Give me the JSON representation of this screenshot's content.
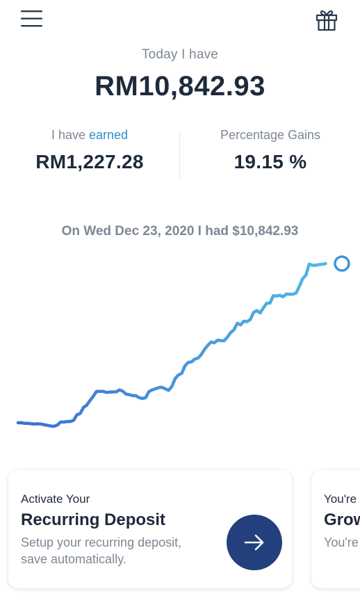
{
  "header": {
    "menu_icon": "hamburger-menu-icon",
    "gift_icon": "gift-icon"
  },
  "summary": {
    "today_label": "Today I have",
    "balance": "RM10,842.93"
  },
  "stats": {
    "earned_prefix": "I have ",
    "earned_accent": "earned",
    "earned_value": "RM1,227.28",
    "gains_label": "Percentage Gains",
    "gains_value": "19.15 %"
  },
  "chart": {
    "caption": "On Wed Dec 23, 2020 I had $10,842.93",
    "line_color_start": "#3d6fcf",
    "line_color_end": "#52b8e6",
    "marker_color": "#3f93d8"
  },
  "chart_data": {
    "type": "line",
    "x": [
      0,
      1,
      2,
      3,
      4,
      5,
      6,
      7,
      8,
      9,
      10,
      11,
      12,
      13,
      14,
      15,
      16,
      17,
      18,
      19,
      20,
      21,
      22,
      23,
      24,
      25,
      26,
      27,
      28,
      29,
      30,
      31,
      32,
      33,
      34,
      35,
      36,
      37,
      38,
      39,
      40,
      41,
      42,
      43,
      44,
      45,
      46,
      47,
      48,
      49,
      50,
      51,
      52,
      53,
      54,
      55,
      56,
      57,
      58,
      59,
      60,
      61,
      62,
      63,
      64,
      65,
      66,
      67,
      68,
      69,
      70,
      71,
      72,
      73,
      74,
      75,
      76,
      77,
      78,
      79,
      80,
      81,
      82,
      83,
      84,
      85,
      86,
      87,
      88,
      89,
      90,
      91,
      92,
      93,
      94,
      95,
      96,
      97,
      98,
      99
    ],
    "values": [
      9614,
      9614,
      9612,
      9612,
      9610,
      9609,
      9610,
      9609,
      9606,
      9604,
      9601,
      9600,
      9605,
      9617,
      9617,
      9619,
      9619,
      9624,
      9646,
      9651,
      9675,
      9684,
      9703,
      9720,
      9739,
      9739,
      9739,
      9735,
      9736,
      9737,
      9737,
      9745,
      9740,
      9728,
      9726,
      9722,
      9722,
      9714,
      9711,
      9714,
      9738,
      9745,
      9749,
      9754,
      9755,
      9749,
      9743,
      9758,
      9789,
      9804,
      9810,
      9840,
      9854,
      9856,
      9867,
      9871,
      9885,
      9906,
      9922,
      9935,
      9932,
      9942,
      9941,
      9940,
      9955,
      9973,
      9984,
      10010,
      10003,
      10018,
      10016,
      10025,
      10053,
      10060,
      10051,
      10071,
      10089,
      10090,
      10119,
      10118,
      10121,
      10115,
      10126,
      10125,
      10125,
      10130,
      10157,
      10187,
      10201,
      10245,
      10240,
      10240,
      10243,
      10244,
      10247
    ],
    "title": "On Wed Dec 23, 2020 I had $10,842.93",
    "grid": false,
    "legend": "none"
  },
  "cards": [
    {
      "kicker": "Activate Your",
      "title": "Recurring Deposit",
      "description": "Setup your recurring deposit, save automatically.",
      "action_icon": "arrow-right-icon"
    },
    {
      "kicker": "You're",
      "title": "Grow",
      "description": "You're make"
    }
  ]
}
